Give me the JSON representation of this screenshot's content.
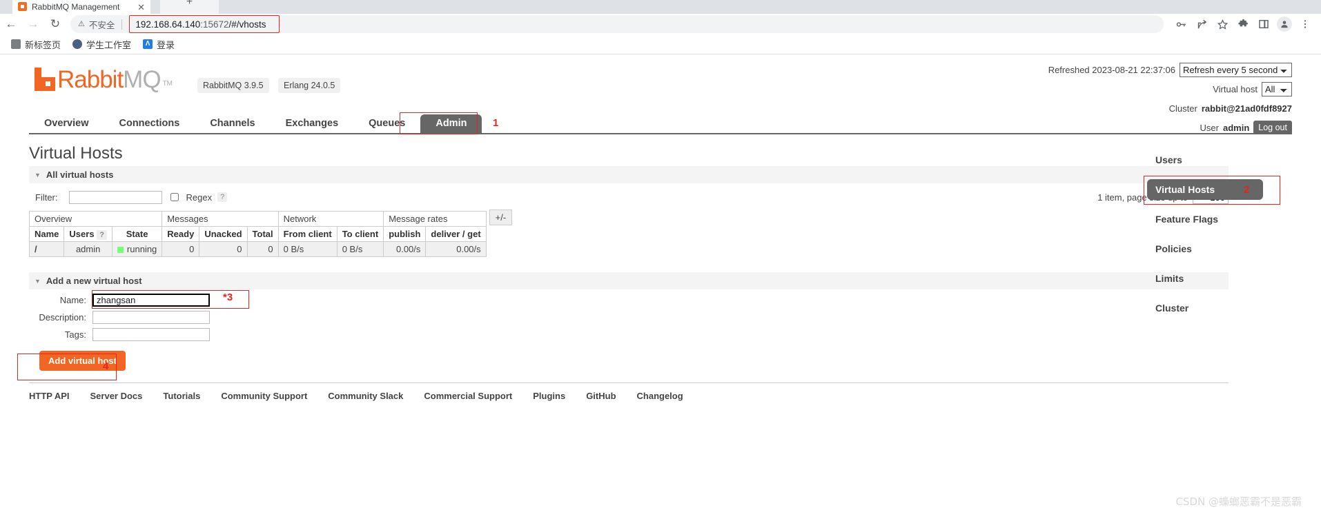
{
  "browser": {
    "tab_title": "RabbitMQ Management",
    "tab_close": "✕",
    "new_tab": "+",
    "back": "←",
    "forward": "→",
    "reload": "↻",
    "warn_glyph": "⚠",
    "not_secure": "不安全",
    "url_main": "192.168.64.140",
    "url_dim": ":15672",
    "url_rest": "/#/vhosts",
    "bookmarks": [
      {
        "label": "新标签页",
        "icon": "new-tab-icon",
        "style": "grey"
      },
      {
        "label": "学生工作室",
        "icon": "school-icon",
        "style": "school"
      },
      {
        "label": "登录",
        "icon": "login-icon",
        "style": "blue",
        "glyph": "Λ"
      }
    ]
  },
  "header": {
    "logo_rabbit": "Rabbit",
    "logo_mq": "MQ",
    "logo_tm": "TM",
    "version_badge": "RabbitMQ 3.9.5",
    "erlang_badge": "Erlang 24.0.5",
    "refreshed_label": "Refreshed 2023-08-21 22:37:06",
    "refresh_select": "Refresh every 5 seconds",
    "vhost_label": "Virtual host",
    "vhost_select": "All",
    "cluster_label": "Cluster",
    "cluster_value": "rabbit@21ad0fdf8927",
    "user_label": "User",
    "user_value": "admin",
    "logout": "Log out"
  },
  "nav": {
    "tabs": [
      {
        "label": "Overview",
        "active": false
      },
      {
        "label": "Connections",
        "active": false
      },
      {
        "label": "Channels",
        "active": false
      },
      {
        "label": "Exchanges",
        "active": false
      },
      {
        "label": "Queues",
        "active": false
      },
      {
        "label": "Admin",
        "active": true
      }
    ]
  },
  "annotations": {
    "one": "1",
    "two": "2",
    "three": "*3",
    "four": "4"
  },
  "main": {
    "page_title": "Virtual Hosts",
    "all_vhosts_section": "All virtual hosts",
    "filter_label": "Filter:",
    "filter_value": "",
    "regex_label": "Regex",
    "help_mark": "?",
    "pager_text": "1 item, page size up to",
    "page_size": "100",
    "plusminus": "+/-",
    "table": {
      "groups": [
        {
          "label": "Overview",
          "span": 3
        },
        {
          "label": "Messages",
          "span": 3
        },
        {
          "label": "Network",
          "span": 2
        },
        {
          "label": "Message rates",
          "span": 2
        }
      ],
      "columns": [
        "Name",
        "Users",
        "State",
        "Ready",
        "Unacked",
        "Total",
        "From client",
        "To client",
        "publish",
        "deliver / get"
      ],
      "users_help": "?",
      "rows": [
        {
          "name": "/",
          "users": "admin",
          "state": "running",
          "ready": "0",
          "unacked": "0",
          "total": "0",
          "from_client": "0 B/s",
          "to_client": "0 B/s",
          "publish": "0.00/s",
          "deliver_get": "0.00/s"
        }
      ]
    },
    "add_section": "Add a new virtual host",
    "form": {
      "name_label": "Name:",
      "name_value": "zhangsan",
      "description_label": "Description:",
      "description_value": "",
      "tags_label": "Tags:",
      "tags_value": "",
      "submit": "Add virtual host"
    }
  },
  "sidebar": {
    "items": [
      {
        "label": "Users",
        "active": false
      },
      {
        "label": "Virtual Hosts",
        "active": true
      },
      {
        "label": "Feature Flags",
        "active": false
      },
      {
        "label": "Policies",
        "active": false
      },
      {
        "label": "Limits",
        "active": false
      },
      {
        "label": "Cluster",
        "active": false
      }
    ]
  },
  "footer": {
    "links": [
      "HTTP API",
      "Server Docs",
      "Tutorials",
      "Community Support",
      "Community Slack",
      "Commercial Support",
      "Plugins",
      "GitHub",
      "Changelog"
    ]
  },
  "watermark": "CSDN @蟂螂恶霸不是恶霸"
}
